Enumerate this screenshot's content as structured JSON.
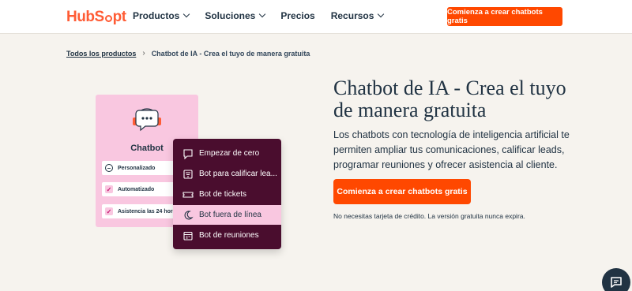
{
  "header": {
    "logo_text_left": "Hub",
    "logo_text_right": "pt",
    "nav": [
      {
        "label": "Productos",
        "has_dropdown": true
      },
      {
        "label": "Soluciones",
        "has_dropdown": true
      },
      {
        "label": "Precios",
        "has_dropdown": false
      },
      {
        "label": "Recursos",
        "has_dropdown": true
      }
    ],
    "cta": "Comienza a crear chatbots gratis"
  },
  "breadcrumb": {
    "parent": "Todos los productos",
    "current": "Chatbot de IA - Crea el tuyo de manera gratuita"
  },
  "hero": {
    "title": "Chatbot de IA - Crea el tuyo de manera gratuita",
    "description": "Los chatbots con tecnología de inteligencia artificial te permiten ampliar tus comunicaciones, calificar leads, programar reuniones y ofrecer asistencia al cliente.",
    "cta": "Comienza a crear chatbots gratis",
    "note": "No necesitas tarjeta de crédito. La versión gratuita nunca expira."
  },
  "illustration": {
    "card_title": "Chatbot",
    "options": [
      {
        "label": "Personalizado",
        "state": "minus"
      },
      {
        "label": "Automatizado",
        "state": "check"
      },
      {
        "label": "Asistencia las 24 horas",
        "state": "check"
      }
    ],
    "menu": [
      {
        "label": "Empezar de cero",
        "icon": "chat-square-icon",
        "active": false
      },
      {
        "label": "Bot para calificar lea...",
        "icon": "filter-icon",
        "active": false
      },
      {
        "label": "Bot de tickets",
        "icon": "ticket-icon",
        "active": false
      },
      {
        "label": "Bot fuera de línea",
        "icon": "moon-icon",
        "active": true
      },
      {
        "label": "Bot de reuniones",
        "icon": "calendar-icon",
        "active": false
      }
    ]
  },
  "colors": {
    "accent": "#ff4800",
    "brand": "#ff5c35",
    "text": "#213343",
    "background": "#f6f3ee",
    "card_pink": "#f9c7e0",
    "menu_dark": "#4a0d2e"
  }
}
